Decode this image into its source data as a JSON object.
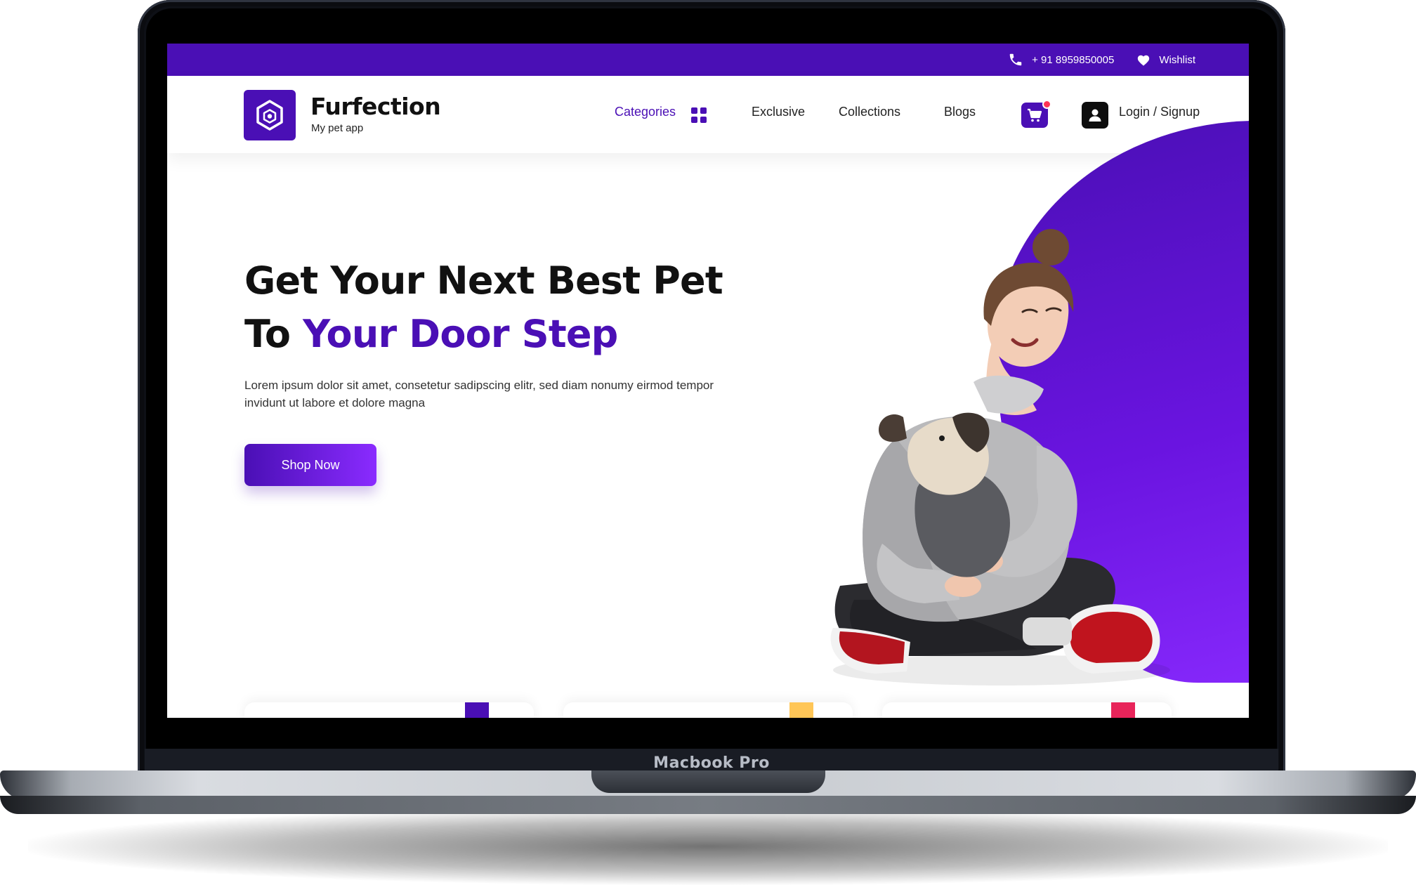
{
  "device": {
    "label": "Macbook Pro"
  },
  "topbar": {
    "phone": "+ 91 8959850005",
    "wishlist": "Wishlist",
    "phone_icon": "phone-icon",
    "wishlist_icon": "heart-icon"
  },
  "header": {
    "brand_name": "Furfection",
    "brand_tagline": "My pet app",
    "nav": {
      "categories": "Categories",
      "exclusive": "Exclusive",
      "collections": "Collections",
      "blogs": "Blogs",
      "login": "Login / Signup"
    },
    "icons": [
      "logo-icon",
      "grid-icon",
      "cart-icon",
      "user-icon"
    ]
  },
  "hero": {
    "title_line1": "Get Your Next Best Pet",
    "title_line2_prefix": "To",
    "title_line2_accent": "Your Door Step",
    "description": "Lorem ipsum dolor sit amet, consetetur sadipscing elitr, sed diam nonumy eirmod tempor invidunt ut labore et dolore magna",
    "cta": "Shop Now"
  },
  "colors": {
    "primary": "#4a0fb5",
    "gradient_end": "#8a2bff",
    "card_accents": [
      "#4a0fb5",
      "#ffc657",
      "#e8245a"
    ]
  }
}
